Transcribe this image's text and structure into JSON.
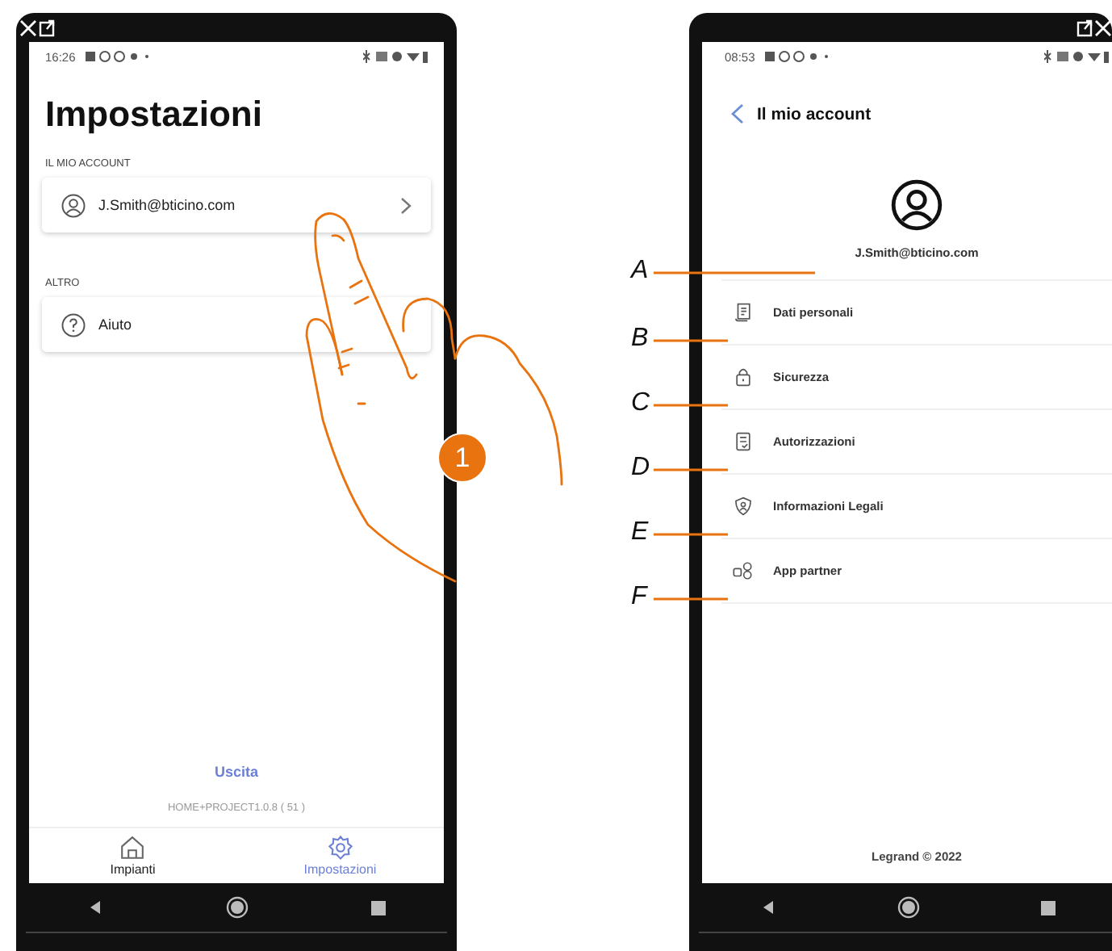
{
  "step_badge": "1",
  "phone_left": {
    "status_time": "16:26",
    "title": "Impostazioni",
    "sections": [
      {
        "header": "IL MIO ACCOUNT",
        "items": [
          {
            "label": "J.Smith@bticino.com",
            "kind": "person",
            "chevron": true
          }
        ]
      },
      {
        "header": "ALTRO",
        "items": [
          {
            "label": "Aiuto",
            "kind": "help",
            "chevron": false
          }
        ]
      }
    ],
    "logout": "Uscita",
    "version": "HOME+PROJECT1.0.8 ( 51 )",
    "tabs": [
      {
        "label": "Impianti",
        "kind": "home",
        "selected": false
      },
      {
        "label": "Impostazioni",
        "kind": "gear",
        "selected": true
      }
    ]
  },
  "phone_right": {
    "status_time": "08:53",
    "header": "Il mio account",
    "account": {
      "email": "J.Smith@bticino.com",
      "callout": "A"
    },
    "menu": [
      {
        "label": "Dati personali",
        "kind": "document",
        "callout": "B"
      },
      {
        "label": "Sicurezza",
        "kind": "lock",
        "callout": "C"
      },
      {
        "label": "Autorizzazioni",
        "kind": "checklist",
        "callout": "D"
      },
      {
        "label": "Informazioni Legali",
        "kind": "shield",
        "callout": "E"
      },
      {
        "label": "App partner",
        "kind": "partner",
        "callout": "F"
      }
    ],
    "footer": "Legrand © 2022"
  }
}
